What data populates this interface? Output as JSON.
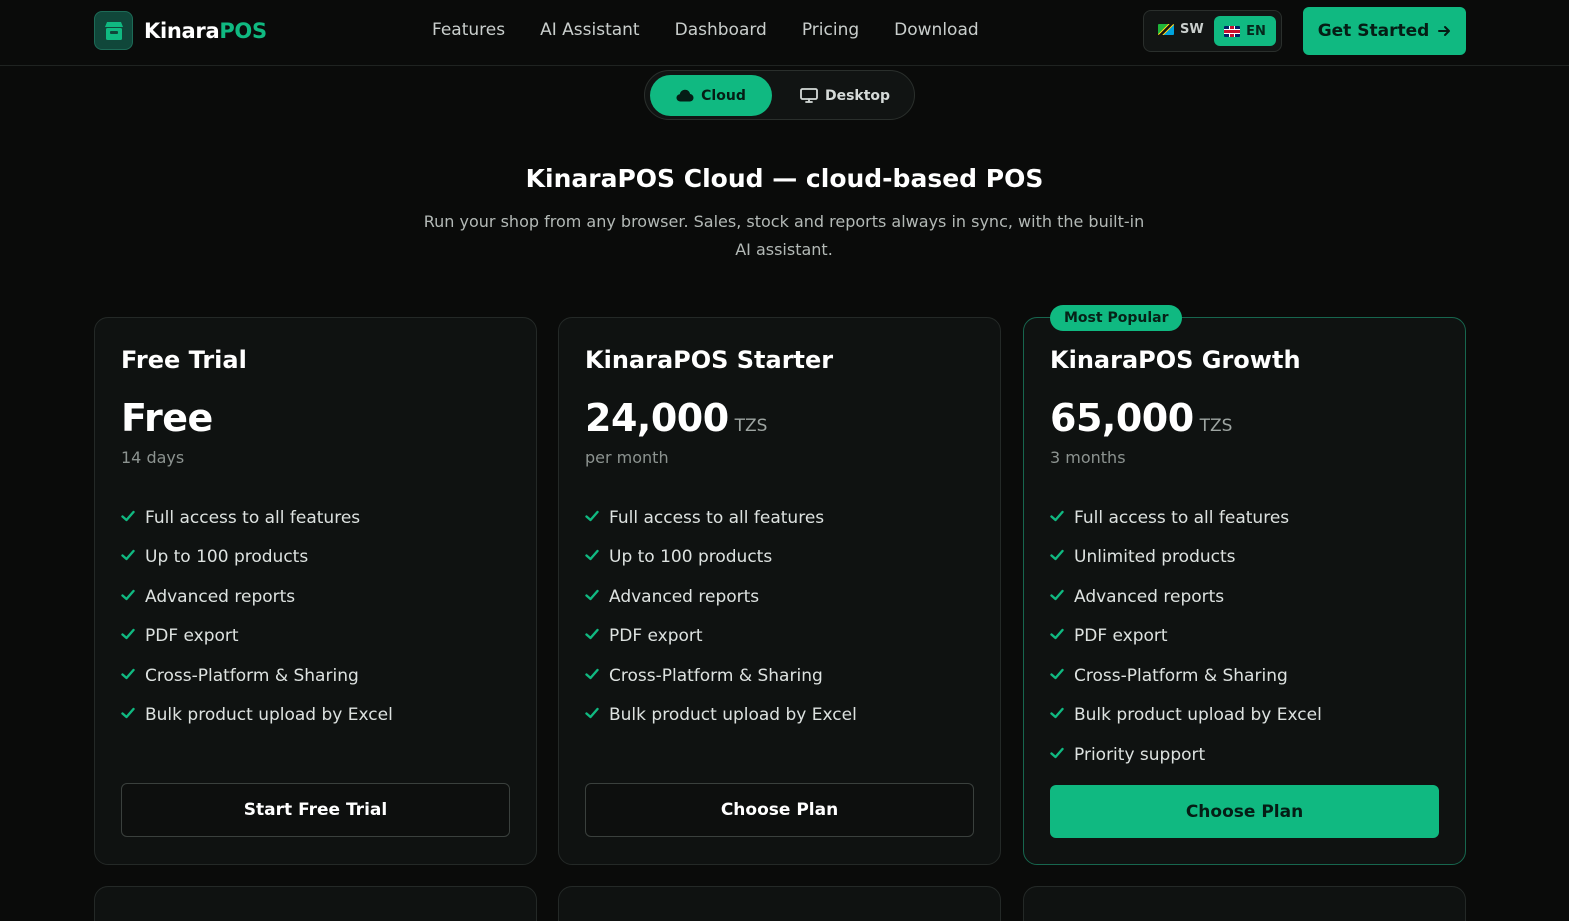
{
  "brand": {
    "name_a": "Kinara",
    "name_b": "POS"
  },
  "nav": {
    "links": [
      "Features",
      "AI Assistant",
      "Dashboard",
      "Pricing",
      "Download"
    ]
  },
  "lang": {
    "sw": "SW",
    "en": "EN",
    "active": "EN"
  },
  "cta": {
    "label": "Get Started"
  },
  "toggle": {
    "cloud": "Cloud",
    "desktop": "Desktop",
    "active": "Cloud"
  },
  "hero": {
    "title": "KinaraPOS Cloud — cloud-based POS",
    "subtitle": "Run your shop from any browser. Sales, stock and reports always in sync, with the built-in AI assistant."
  },
  "plans": [
    {
      "name": "Free Trial",
      "amount": "Free",
      "currency": "",
      "period": "14 days",
      "features": [
        "Full access to all features",
        "Up to 100 products",
        "Advanced reports",
        "PDF export",
        "Cross-Platform & Sharing",
        "Bulk product upload by Excel"
      ],
      "button": "Start Free Trial"
    },
    {
      "name": "KinaraPOS Starter",
      "amount": "24,000",
      "currency": "TZS",
      "period": "per month",
      "features": [
        "Full access to all features",
        "Up to 100 products",
        "Advanced reports",
        "PDF export",
        "Cross-Platform & Sharing",
        "Bulk product upload by Excel"
      ],
      "button": "Choose Plan"
    },
    {
      "name": "KinaraPOS Growth",
      "badge": "Most Popular",
      "amount": "65,000",
      "currency": "TZS",
      "period": "3 months",
      "features": [
        "Full access to all features",
        "Unlimited products",
        "Advanced reports",
        "PDF export",
        "Cross-Platform & Sharing",
        "Bulk product upload by Excel",
        "Priority support"
      ],
      "button": "Choose Plan"
    }
  ],
  "colors": {
    "accent": "#10b981",
    "background": "#0a0b0a",
    "card": "#0f1211"
  }
}
